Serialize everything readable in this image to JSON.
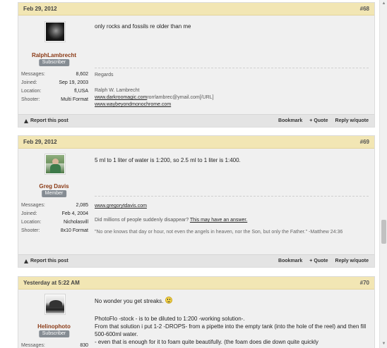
{
  "posts": [
    {
      "date": "Feb 29, 2012",
      "number": "#68",
      "user": {
        "name": "RalphLambrecht",
        "badge": "Subscriber",
        "avatar": "dark-portrait",
        "stats": [
          {
            "label": "Messages:",
            "value": "8,602"
          },
          {
            "label": "Joined:",
            "value": "Sep 19, 2003"
          },
          {
            "label": "Location:",
            "value": "fl,USA"
          },
          {
            "label": "Shooter:",
            "value": "Multi Format"
          }
        ]
      },
      "message": [
        "only rocks and fossils re older than me"
      ],
      "signature": {
        "line1": "Regards",
        "line2": "Ralph W. Lambrecht",
        "link1": "www.darkroomagic.com",
        "link1_tail": "rorrlambrec@ymail.com[/URL]",
        "link2": "www.waybeyondmonochrome.com"
      },
      "footer": {
        "report": "Report this post",
        "bookmark": "Bookmark",
        "quote": "+ Quote",
        "reply": "Reply w/quote"
      }
    },
    {
      "date": "Feb 29, 2012",
      "number": "#69",
      "user": {
        "name": "Greg Davis",
        "badge": "Member",
        "avatar": "man-outdoors",
        "stats": [
          {
            "label": "Messages:",
            "value": "2,085"
          },
          {
            "label": "Joined:",
            "value": "Feb 4, 2004"
          },
          {
            "label": "Location:",
            "value": "Nicholasvill"
          },
          {
            "label": "Shooter:",
            "value": "8x10 Format"
          }
        ]
      },
      "message": [
        "5 ml to 1 liter of water is 1:200, so 2.5 ml to 1 liter is 1:400."
      ],
      "signature": {
        "link1": "www.gregorytdavis.com",
        "line2_pre": "Did millions of people suddenly disappear? ",
        "line2_link": "This may have an answer.",
        "quote": "\"No one knows that day or hour, not even the angels in heaven, nor the Son, but only the Father.\" -Matthew 24:36"
      },
      "footer": {
        "report": "Report this post",
        "bookmark": "Bookmark",
        "quote": "+ Quote",
        "reply": "Reply w/quote"
      }
    },
    {
      "date": "Yesterday at 5:22 AM",
      "number": "#70",
      "user": {
        "name": "Helinophoto",
        "badge": "Subscriber",
        "avatar": "bw-landscape",
        "stats": [
          {
            "label": "Messages:",
            "value": "830"
          }
        ]
      },
      "message": [
        "No wonder you get streaks.",
        "PhotoFlo -stock - is to be diluted to 1:200 -working solution-.",
        "From that solution i put 1-2 -DROPS- from a pipette into the empty tank (into the hole of the reel) and then fill 500-600ml water.",
        "- even that is enough for it to foam quite beautifully. (the foam does die down quite quickly"
      ],
      "smiley": "smiley-icon"
    }
  ]
}
